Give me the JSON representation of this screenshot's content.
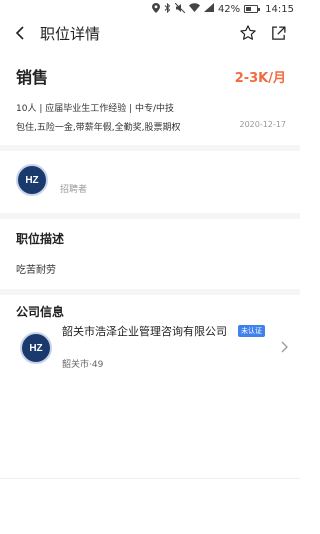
{
  "status_bar": {
    "battery_percent": "42%",
    "time": "14:15"
  },
  "nav": {
    "title": "职位详情"
  },
  "job": {
    "title": "销售",
    "salary": "2-3K/月",
    "meta": "10人 | 应届毕业生工作经验 | 中专/中技",
    "benefits": "包住,五险一金,带薪年假,全勤奖,股票期权",
    "date": "2020-12-17"
  },
  "recruiter": {
    "logo_text": "HZ",
    "role": "招聘者"
  },
  "description": {
    "heading": "职位描述",
    "text": "吃苦耐劳"
  },
  "company": {
    "heading": "公司信息",
    "logo_text": "HZ",
    "name": "韶关市浩泽企业管理咨询有限公司",
    "badge": "未认证",
    "location": "韶关市·49"
  },
  "colors": {
    "salary": "#f06b3f",
    "badge": "#3f82ee"
  }
}
